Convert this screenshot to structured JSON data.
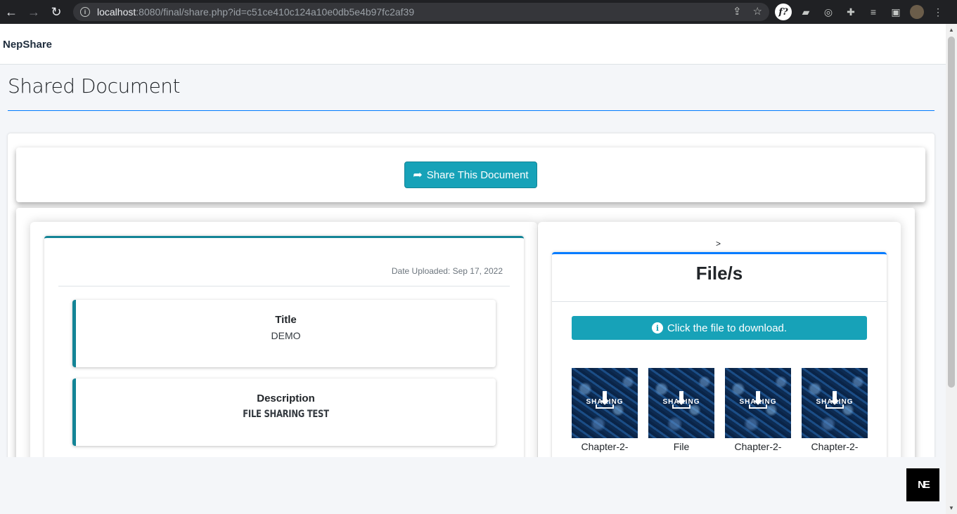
{
  "browser": {
    "url_host": "localhost",
    "url_rest": ":8080/final/share.php?id=c51ce410c124a10e0db5e4b97fc2af39"
  },
  "app": {
    "brand": "NepShare",
    "page_title": "Shared Document",
    "share_button_label": "Share This Document"
  },
  "document": {
    "date_uploaded": "Date Uploaded: Sep 17, 2022",
    "title_label": "Title",
    "title_value": "DEMO",
    "description_label": "Description",
    "description_value": "FILE SHARING TEST"
  },
  "files": {
    "breadcrumb_symbol": ">",
    "heading": "File/s",
    "hint": "Click the file to download.",
    "thumbnail_text": "SHARING",
    "items": [
      {
        "name": "Chapter-2-"
      },
      {
        "name": "File"
      },
      {
        "name": "Chapter-2-"
      },
      {
        "name": "Chapter-2-"
      }
    ]
  },
  "badge": {
    "text": "NE"
  },
  "colors": {
    "accent_teal": "#17a2b8",
    "border_teal": "#138496",
    "primary_blue": "#007bff"
  }
}
